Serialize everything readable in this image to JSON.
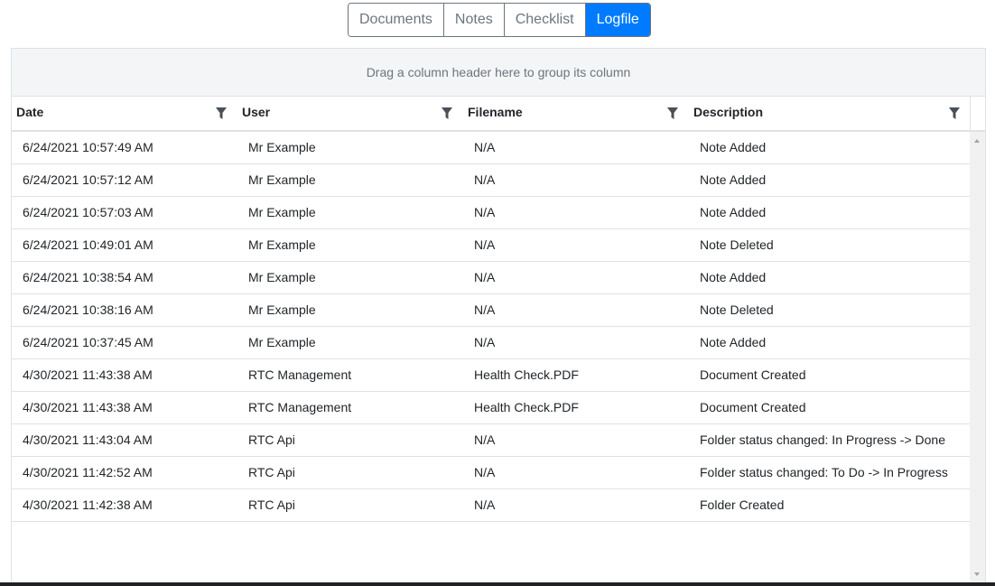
{
  "tabs": [
    {
      "label": "Documents",
      "active": false
    },
    {
      "label": "Notes",
      "active": false
    },
    {
      "label": "Checklist",
      "active": false
    },
    {
      "label": "Logfile",
      "active": true
    }
  ],
  "grid": {
    "group_panel_text": "Drag a column header here to group its column",
    "columns": [
      "Date",
      "User",
      "Filename",
      "Description"
    ],
    "filter_icon": "filter-icon",
    "rows": [
      {
        "date": "6/24/2021 10:57:49 AM",
        "user": "Mr Example",
        "filename": "N/A",
        "description": "Note Added"
      },
      {
        "date": "6/24/2021 10:57:12 AM",
        "user": "Mr Example",
        "filename": "N/A",
        "description": "Note Added"
      },
      {
        "date": "6/24/2021 10:57:03 AM",
        "user": "Mr Example",
        "filename": "N/A",
        "description": "Note Added"
      },
      {
        "date": "6/24/2021 10:49:01 AM",
        "user": "Mr Example",
        "filename": "N/A",
        "description": "Note Deleted"
      },
      {
        "date": "6/24/2021 10:38:54 AM",
        "user": "Mr Example",
        "filename": "N/A",
        "description": "Note Added"
      },
      {
        "date": "6/24/2021 10:38:16 AM",
        "user": "Mr Example",
        "filename": "N/A",
        "description": "Note Deleted"
      },
      {
        "date": "6/24/2021 10:37:45 AM",
        "user": "Mr Example",
        "filename": "N/A",
        "description": "Note Added"
      },
      {
        "date": "4/30/2021 11:43:38 AM",
        "user": "RTC Management",
        "filename": "Health Check.PDF",
        "description": "Document Created"
      },
      {
        "date": "4/30/2021 11:43:38 AM",
        "user": "RTC Management",
        "filename": "Health Check.PDF",
        "description": "Document Created"
      },
      {
        "date": "4/30/2021 11:43:04 AM",
        "user": "RTC Api",
        "filename": "N/A",
        "description": "Folder status changed: In Progress -> Done"
      },
      {
        "date": "4/30/2021 11:42:52 AM",
        "user": "RTC Api",
        "filename": "N/A",
        "description": "Folder status changed: To Do -> In Progress"
      },
      {
        "date": "4/30/2021 11:42:38 AM",
        "user": "RTC Api",
        "filename": "N/A",
        "description": "Folder Created"
      }
    ]
  },
  "colors": {
    "accent": "#007bff",
    "tab_text": "#6c757d",
    "group_panel_bg": "#f4f5f6",
    "border": "#dee2e6"
  }
}
